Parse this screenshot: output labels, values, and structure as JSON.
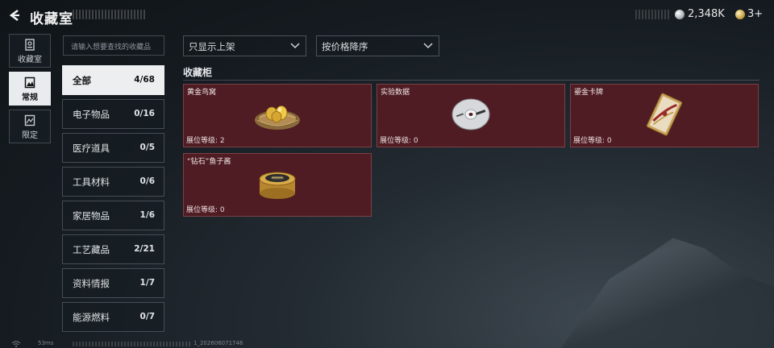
{
  "header": {
    "title": "收藏室",
    "silver_amount": "2,348K",
    "gold_amount": "3+"
  },
  "nav": [
    {
      "label": "收藏室",
      "icon": "collection-room-icon",
      "active": false
    },
    {
      "label": "常规",
      "icon": "regular-icon",
      "active": true
    },
    {
      "label": "限定",
      "icon": "limited-icon",
      "active": false
    }
  ],
  "search": {
    "placeholder": "请输入想要查找的收藏品"
  },
  "filters": {
    "shelf_filter": "只显示上架",
    "sort_order": "按价格降序"
  },
  "categories": [
    {
      "name": "全部",
      "count": "4/68",
      "active": true
    },
    {
      "name": "电子物品",
      "count": "0/16"
    },
    {
      "name": "医疗道具",
      "count": "0/5"
    },
    {
      "name": "工具材料",
      "count": "0/6"
    },
    {
      "name": "家居物品",
      "count": "1/6"
    },
    {
      "name": "工艺藏品",
      "count": "2/21"
    },
    {
      "name": "资料情报",
      "count": "1/7"
    },
    {
      "name": "能源燃料",
      "count": "0/7"
    }
  ],
  "section": {
    "title": "收藏柜"
  },
  "items": [
    {
      "name": "黄金鸟窝",
      "level": "展位等级: 2",
      "icon": "golden-nest-icon"
    },
    {
      "name": "实验数据",
      "level": "展位等级: 0",
      "icon": "data-disc-icon"
    },
    {
      "name": "鎏金卡牌",
      "level": "展位等级: 0",
      "icon": "gilded-card-icon"
    },
    {
      "name": "“钻石”鱼子酱",
      "level": "展位等级: 0",
      "icon": "caviar-tin-icon"
    }
  ],
  "footer": {
    "ping": "53ms",
    "build": "1_202606071746"
  },
  "colors": {
    "card_bg": "#4e1c22",
    "active_tab_bg": "#e9ecee",
    "background": "#1b2228"
  }
}
